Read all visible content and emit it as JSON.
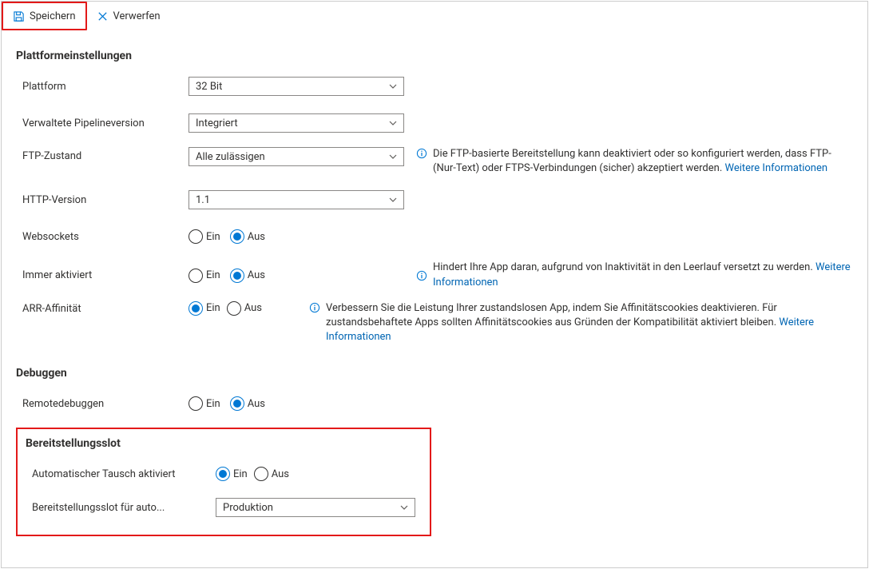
{
  "toolbar": {
    "save_label": "Speichern",
    "discard_label": "Verwerfen"
  },
  "sections": {
    "platform_heading": "Plattformeinstellungen",
    "debug_heading": "Debuggen",
    "deploy_heading": "Bereitstellungsslot"
  },
  "platformSettings": {
    "platform_label": "Plattform",
    "platform_value": "32 Bit",
    "pipeline_label": "Verwaltete Pipelineversion",
    "pipeline_value": "Integriert",
    "ftp_label": "FTP-Zustand",
    "ftp_value": "Alle zulässigen",
    "ftp_help": "Die FTP-basierte Bereitstellung kann deaktiviert oder so konfiguriert werden, dass FTP-(Nur-Text) oder FTPS-Verbindungen (sicher) akzeptiert werden. ",
    "ftp_link": "Weitere Informationen",
    "http_label": "HTTP-Version",
    "http_value": "1.1",
    "websockets_label": "Websockets",
    "always_on_label": "Immer aktiviert",
    "always_on_help": "Hindert Ihre App daran, aufgrund von Inaktivität in den Leerlauf versetzt zu werden. ",
    "always_on_link": "Weitere Informationen",
    "arr_label": "ARR-Affinität",
    "arr_help": "Verbessern Sie die Leistung Ihrer zustandslosen App, indem Sie Affinitätscookies deaktivieren. Für zustandsbehaftete Apps sollten Affinitätscookies aus Gründen der Kompatibilität aktiviert bleiben. ",
    "arr_link": "Weitere Informationen"
  },
  "radio": {
    "on_label": "Ein",
    "off_label": "Aus"
  },
  "debug": {
    "remote_label": "Remotedebuggen"
  },
  "deploy": {
    "auto_swap_label": "Automatischer Tausch aktiviert",
    "slot_label": "Bereitstellungsslot für auto...",
    "slot_value": "Produktion"
  }
}
